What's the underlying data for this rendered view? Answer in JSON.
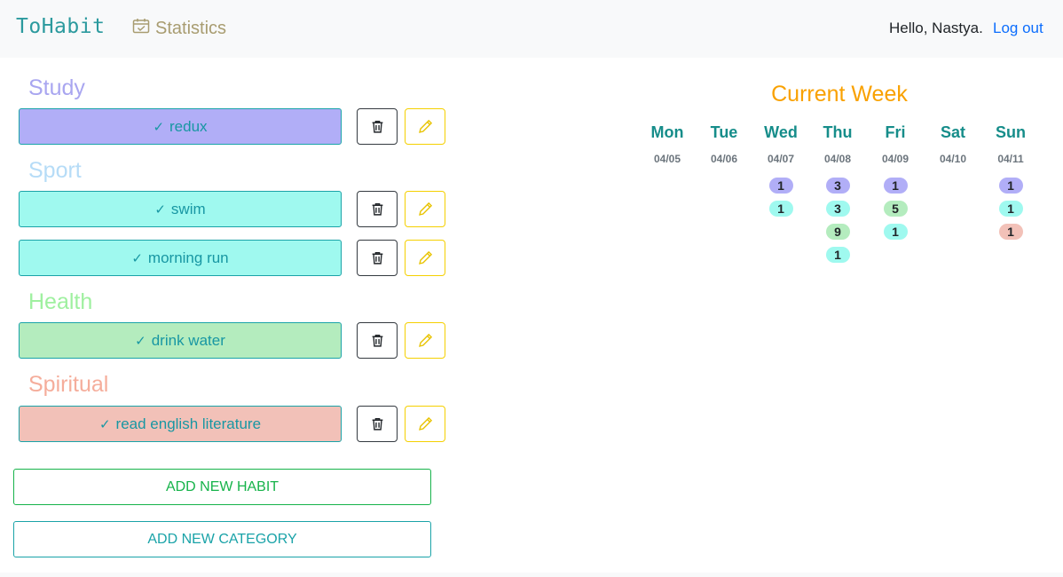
{
  "nav": {
    "brand": "ToHabit",
    "statistics_label": "Statistics",
    "statistics_icon": "calendar-check-icon",
    "greeting": "Hello, Nastya.",
    "logout_label": "Log out"
  },
  "categories": [
    {
      "name": "Study",
      "color": "#a9a6f0",
      "habits": [
        {
          "label": "redux",
          "color": "#b1aef7"
        }
      ]
    },
    {
      "name": "Sport",
      "color": "#b6dcf7",
      "habits": [
        {
          "label": "swim",
          "color": "#9ff9ef"
        },
        {
          "label": "morning run",
          "color": "#9ff9ef"
        }
      ]
    },
    {
      "name": "Health",
      "color": "#9ff0a0",
      "habits": [
        {
          "label": "drink water",
          "color": "#b4ecbe"
        }
      ]
    },
    {
      "name": "Spiritual",
      "color": "#f5ad9b",
      "habits": [
        {
          "label": "read english literature",
          "color": "#f2c1b8"
        }
      ]
    }
  ],
  "actions": {
    "add_habit": "ADD NEW HABIT",
    "add_category": "ADD NEW CATEGORY"
  },
  "week": {
    "title": "Current Week",
    "days": [
      {
        "name": "Mon",
        "date": "04/05",
        "counts": []
      },
      {
        "name": "Tue",
        "date": "04/06",
        "counts": []
      },
      {
        "name": "Wed",
        "date": "04/07",
        "counts": [
          {
            "value": "1",
            "color": "#b1aef7"
          },
          {
            "value": "1",
            "color": "#9ff9ef"
          }
        ]
      },
      {
        "name": "Thu",
        "date": "04/08",
        "counts": [
          {
            "value": "3",
            "color": "#b1aef7"
          },
          {
            "value": "3",
            "color": "#9ff9ef"
          },
          {
            "value": "9",
            "color": "#b4ecbe"
          },
          {
            "value": "1",
            "color": "#9ff9ef"
          }
        ]
      },
      {
        "name": "Fri",
        "date": "04/09",
        "counts": [
          {
            "value": "1",
            "color": "#b1aef7"
          },
          {
            "value": "5",
            "color": "#b4ecbe"
          },
          {
            "value": "1",
            "color": "#9ff9ef"
          }
        ]
      },
      {
        "name": "Sat",
        "date": "04/10",
        "counts": []
      },
      {
        "name": "Sun",
        "date": "04/11",
        "counts": [
          {
            "value": "1",
            "color": "#b1aef7"
          },
          {
            "value": "1",
            "color": "#9ff9ef"
          },
          {
            "value": "1",
            "color": "#f2c1b8"
          }
        ]
      }
    ]
  },
  "colors": {
    "brand": "#2c9a9e",
    "week_title": "#f9a100",
    "add_habit": "#16b34a",
    "add_category": "#1aa3a8"
  }
}
